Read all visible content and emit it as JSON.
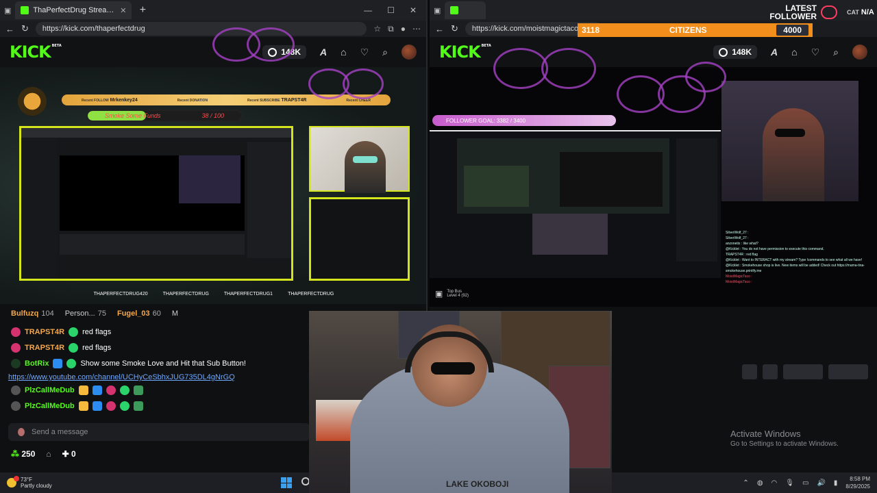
{
  "left_browser": {
    "tab_title": "ThaPerfectDrug Stream - Watch L",
    "url": "https://kick.com/thaperfectdrug",
    "viewers": "148K",
    "stream": {
      "alerts": [
        {
          "label": "Recent FOLLOW",
          "name": "Mrkenkey24"
        },
        {
          "label": "Recent DONATION",
          "name": ""
        },
        {
          "label": "Recent SUBSCRIBE",
          "name": "TRAPST4R"
        },
        {
          "label": "Recent CHEER",
          "name": ""
        }
      ],
      "goal_label": "Smoke Some Funds",
      "goal_value": "38 / 100",
      "goal_fraction": 0.38,
      "socials": [
        "THAPERFECTDRUG420",
        "THAPERFECTDRUG",
        "THAPERFECTDRUG1",
        "THAPERFECTDRUG"
      ]
    },
    "gifters": [
      {
        "name": "Bulfuzq",
        "count": "104"
      },
      {
        "name": "Person...",
        "count": "75"
      },
      {
        "name": "Fugel_03",
        "count": "60"
      },
      {
        "name": "M",
        "count": ""
      }
    ],
    "chat": [
      {
        "user": "TRAPST4R",
        "color": "#f6a84c",
        "message": "red flags"
      },
      {
        "user": "TRAPST4R",
        "color": "#f6a84c",
        "message": "red flags"
      },
      {
        "user": "BotRix",
        "color": "#53fc18",
        "message": "Show some Smoke Love and Hit that Sub Button!"
      },
      {
        "user": "PlzCallMeDub",
        "color": "#53fc18",
        "message": ""
      },
      {
        "user": "PlzCallMeDub",
        "color": "#53fc18",
        "message": ""
      }
    ],
    "link": "https://www.youtube.com/channel/UCHyCeSbhxJUG735DL4gNrGQ",
    "send_placeholder": "Send a message",
    "points": "250",
    "plus_count": "0"
  },
  "right_browser": {
    "url": "https://kick.com/moistmagictaco",
    "viewers": "148K",
    "overlay": {
      "count": "3118",
      "label": "CITIZENS",
      "goal": "4000",
      "latest_follower_title": "LATEST",
      "latest_follower_sub": "FOLLOWER",
      "latest_follower_name": "N/A",
      "cat_prefix": "CAT"
    },
    "follower_goal": "FOLLOWER GOAL: 3382 / 3400",
    "top_bus": {
      "title": "Top Bus",
      "level": "Level 4 (92)"
    },
    "chat_lines": [
      "SilverWolf_27 :",
      "SilverWolf_27 :",
      "anzonetix : like what?",
      "@Kicklet : You do not have permission to execute this command.",
      "TRAPST4R : red flag",
      "@Kicklet : Want to INTERACT with my stream? Type !commands to see what all we have!",
      "@Kicklet : Smokehouse shop is live. New items will be added! Check out https://mama-tina-smokehouse.printify.me",
      "MoistMagicTaco :",
      "MoistMagicTaco :"
    ]
  },
  "windows": {
    "activate_title": "Activate Windows",
    "activate_sub": "Go to Settings to activate Windows."
  },
  "taskbar": {
    "temp": "73°F",
    "weather": "Partly cloudy",
    "time": "8:58 PM",
    "date": "8/29/2025"
  },
  "webcam": {
    "hoodie_text": "LAKE OKOBOJI"
  },
  "colors": {
    "kick_green": "#53fc18",
    "overlay_orange": "#f28e1c",
    "border_yellow": "#d5e51d"
  }
}
